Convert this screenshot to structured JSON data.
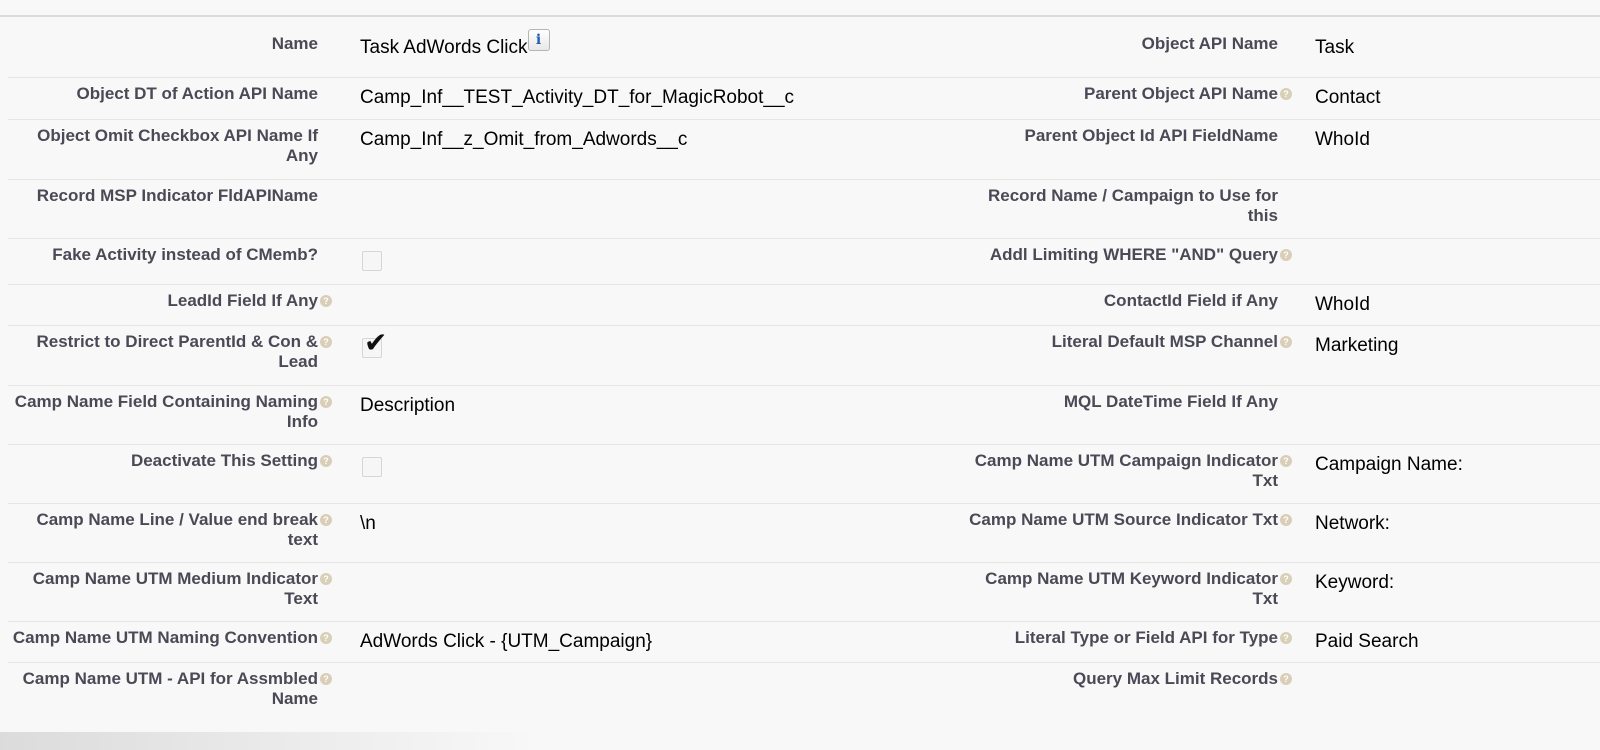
{
  "rows": [
    {
      "left_label": "Name",
      "left_help": false,
      "left_value": "Task AdWords Click",
      "left_info": true,
      "right_label": "Object API Name",
      "right_help": false,
      "right_value": "Task"
    },
    {
      "left_label": "Object DT of Action API Name",
      "left_help": false,
      "left_value": "Camp_Inf__TEST_Activity_DT_for_MagicRobot__c",
      "right_label": "Parent Object API Name",
      "right_help": true,
      "right_value": "Contact"
    },
    {
      "left_label": "Object Omit Checkbox API Name If Any",
      "left_help": false,
      "left_value": "Camp_Inf__z_Omit_from_Adwords__c",
      "right_label": "Parent Object Id API FieldName",
      "right_help": false,
      "right_value": "WhoId"
    },
    {
      "left_label": "Record MSP Indicator FldAPIName",
      "left_help": false,
      "left_value": "",
      "right_label": "Record Name / Campaign to Use for this",
      "right_help": false,
      "right_value": ""
    },
    {
      "left_label": "Fake Activity instead of CMemb?",
      "left_help": false,
      "left_checkbox": false,
      "right_label": "Addl Limiting WHERE \"AND\" Query",
      "right_help": true,
      "right_value": ""
    },
    {
      "left_label": "LeadId Field If Any",
      "left_help": true,
      "left_value": "",
      "right_label": "ContactId Field if Any",
      "right_help": false,
      "right_value": "WhoId"
    },
    {
      "left_label": "Restrict to Direct ParentId & Con & Lead",
      "left_help": true,
      "left_checkbox": true,
      "right_label": "Literal Default MSP Channel",
      "right_help": true,
      "right_value": "Marketing"
    },
    {
      "left_label": "Camp Name Field Containing Naming Info",
      "left_help": true,
      "left_value": "Description",
      "right_label": "MQL DateTime Field If Any",
      "right_help": false,
      "right_value": ""
    },
    {
      "left_label": "Deactivate This Setting",
      "left_help": true,
      "left_checkbox": false,
      "right_label": "Camp Name UTM Campaign Indicator Txt",
      "right_help": true,
      "right_value": "Campaign Name:"
    },
    {
      "left_label": "Camp Name Line / Value end break text",
      "left_help": true,
      "left_value": "\\n",
      "right_label": "Camp Name UTM Source Indicator Txt",
      "right_help": true,
      "right_value": "Network:"
    },
    {
      "left_label": "Camp Name UTM Medium Indicator Text",
      "left_help": true,
      "left_value": "",
      "right_label": "Camp Name UTM Keyword Indicator Txt",
      "right_help": true,
      "right_value": "Keyword:"
    },
    {
      "left_label": "Camp Name UTM Naming Convention",
      "left_help": true,
      "left_value": "AdWords Click - {UTM_Campaign}",
      "right_label": "Literal Type or Field API for Type",
      "right_help": true,
      "right_value": "Paid Search"
    },
    {
      "left_label": "Camp Name UTM - API for Assmbled Name",
      "left_help": true,
      "left_value": "",
      "right_label": "Query Max Limit Records",
      "right_help": true,
      "right_value": ""
    }
  ],
  "icons": {
    "help": "help-icon",
    "info": "info-icon",
    "check": "checkmark-icon"
  },
  "colors": {
    "label": "#4a4a56",
    "help_icon": "#d9cfb8",
    "background": "#f8f8f8"
  }
}
